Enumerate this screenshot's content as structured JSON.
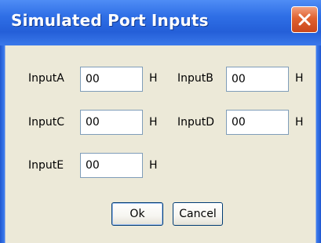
{
  "window": {
    "title": "Simulated Port Inputs"
  },
  "inputs": [
    {
      "label": "InputA",
      "value": "00",
      "suffix": "H"
    },
    {
      "label": "InputB",
      "value": "00",
      "suffix": "H"
    },
    {
      "label": "InputC",
      "value": "00",
      "suffix": "H"
    },
    {
      "label": "InputD",
      "value": "00",
      "suffix": "H"
    },
    {
      "label": "InputE",
      "value": "00",
      "suffix": "H"
    }
  ],
  "buttons": {
    "ok_label": "Ok",
    "cancel_label": "Cancel"
  },
  "colors": {
    "titlebar": "#2f6fe6",
    "dialog_bg": "#ece9d8",
    "close_button": "#e0612f"
  }
}
